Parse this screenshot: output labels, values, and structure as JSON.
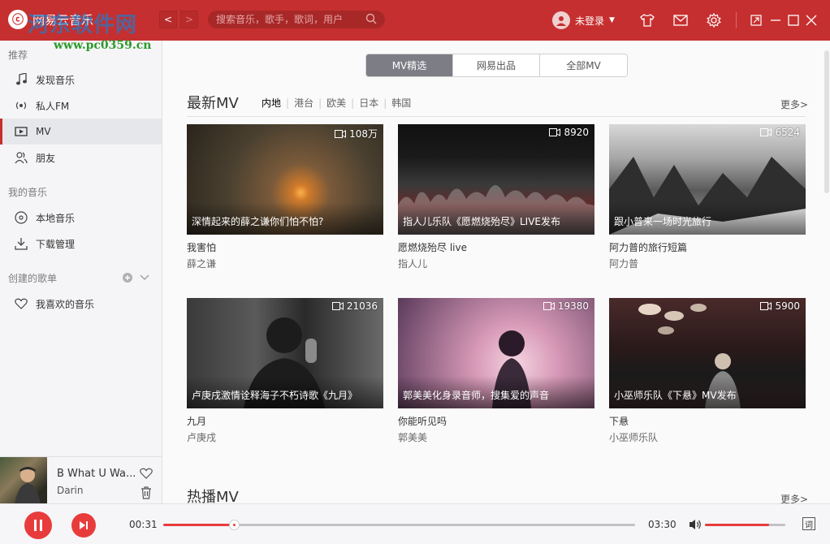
{
  "app": {
    "name": "网易云音乐",
    "watermark_big": "河东软件网",
    "watermark_url": "www.pc0359.cn"
  },
  "topbar": {
    "back": "<",
    "forward": ">",
    "search_placeholder": "搜索音乐，歌手，歌词，用户",
    "user_label": "未登录",
    "colors": {
      "brand": "#c62f2f"
    }
  },
  "sidebar": {
    "group_recommend": "推荐",
    "items_recommend": [
      {
        "label": "发现音乐",
        "icon": "music-note-icon"
      },
      {
        "label": "私人FM",
        "icon": "radio-icon"
      },
      {
        "label": "MV",
        "icon": "video-icon",
        "active": true
      },
      {
        "label": "朋友",
        "icon": "friends-icon"
      }
    ],
    "group_my_music": "我的音乐",
    "items_my_music": [
      {
        "label": "本地音乐",
        "icon": "disc-icon"
      },
      {
        "label": "下载管理",
        "icon": "download-icon"
      }
    ],
    "group_created": "创建的歌单",
    "items_created": [
      {
        "label": "我喜欢的音乐",
        "icon": "heart-icon"
      }
    ]
  },
  "now_playing": {
    "title": "B What U Wa...",
    "artist": "Darin"
  },
  "main": {
    "tabs": [
      {
        "label": "MV精选",
        "active": true
      },
      {
        "label": "网易出品",
        "active": false
      },
      {
        "label": "全部MV",
        "active": false
      }
    ],
    "latest": {
      "title": "最新MV",
      "filters": [
        "内地",
        "港台",
        "欧美",
        "日本",
        "韩国"
      ],
      "active_filter": "内地",
      "more": "更多>",
      "cards": [
        {
          "caption": "深情起来的薛之谦你们怕不怕?",
          "count": "108万",
          "title": "我害怕",
          "artist": "薛之谦"
        },
        {
          "caption": "指人儿乐队《愿燃烧殆尽》LIVE发布",
          "count": "8920",
          "title": "愿燃烧殆尽 live",
          "artist": "指人儿"
        },
        {
          "caption": "跟小普来一场时光旅行",
          "count": "6524",
          "title": "阿力普的旅行短篇",
          "artist": "阿力普"
        },
        {
          "caption": "卢庚戌激情诠释海子不朽诗歌《九月》",
          "count": "21036",
          "title": "九月",
          "artist": "卢庚戌"
        },
        {
          "caption": "郭美美化身录音师，搜集爱的声音",
          "count": "19380",
          "title": "你能听见吗",
          "artist": "郭美美"
        },
        {
          "caption": "小巫师乐队《下悬》MV发布",
          "count": "5900",
          "title": "下悬",
          "artist": "小巫师乐队"
        }
      ]
    },
    "hot": {
      "title": "热播MV",
      "more": "更多>"
    }
  },
  "player": {
    "current_time": "00:31",
    "total_time": "03:30",
    "progress": 0.15,
    "volume": 0.8,
    "lyric_label": "词"
  }
}
